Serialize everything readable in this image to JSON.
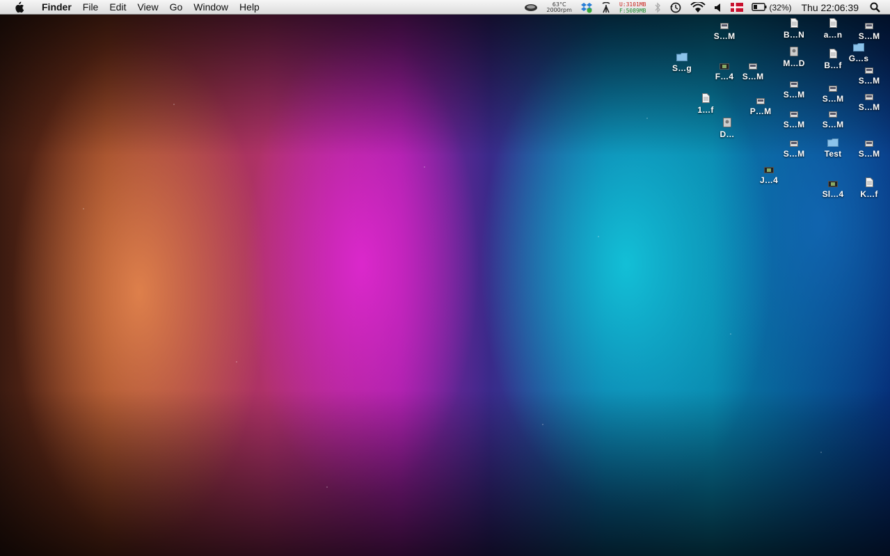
{
  "menubar": {
    "app_name": "Finder",
    "menus": [
      "File",
      "Edit",
      "View",
      "Go",
      "Window",
      "Help"
    ],
    "status": {
      "temperature": "63°C",
      "fan_speed": "2000rpm",
      "memory_used": "U:3101MB",
      "memory_free": "F:5089MB",
      "battery_percent": "(32%)",
      "clock": "Thu 22:06:39"
    },
    "icons": [
      "apple-icon",
      "fan-monitor-icon",
      "dropbox-icon",
      "network-icon",
      "bluetooth-icon",
      "time-machine-icon",
      "wifi-icon",
      "volume-icon",
      "flag-icon",
      "battery-icon",
      "spotlight-icon"
    ]
  },
  "desktop": {
    "icons": [
      {
        "label": "S…M",
        "kind": "screenshot"
      },
      {
        "label": "B…N",
        "kind": "document"
      },
      {
        "label": "a…n",
        "kind": "document"
      },
      {
        "label": "S…M",
        "kind": "screenshot"
      },
      {
        "label": "S…g",
        "kind": "folder"
      },
      {
        "label": "F…4",
        "kind": "video"
      },
      {
        "label": "S…M",
        "kind": "screenshot"
      },
      {
        "label": "M…D",
        "kind": "disk"
      },
      {
        "label": "B…f",
        "kind": "document"
      },
      {
        "label": "G…s",
        "kind": "folder"
      },
      {
        "label": "S…M",
        "kind": "screenshot"
      },
      {
        "label": "S…M",
        "kind": "screenshot"
      },
      {
        "label": "S…M",
        "kind": "screenshot"
      },
      {
        "label": "1…f",
        "kind": "document"
      },
      {
        "label": "P…M",
        "kind": "screenshot"
      },
      {
        "label": "S…M",
        "kind": "screenshot"
      },
      {
        "label": "D…",
        "kind": "disk"
      },
      {
        "label": "S…M",
        "kind": "screenshot"
      },
      {
        "label": "S…M",
        "kind": "screenshot"
      },
      {
        "label": "S…M",
        "kind": "screenshot"
      },
      {
        "label": "Test",
        "kind": "folder"
      },
      {
        "label": "S…M",
        "kind": "screenshot"
      },
      {
        "label": "J…4",
        "kind": "video"
      },
      {
        "label": "Sl…4",
        "kind": "video"
      },
      {
        "label": "K…f",
        "kind": "document"
      }
    ]
  }
}
